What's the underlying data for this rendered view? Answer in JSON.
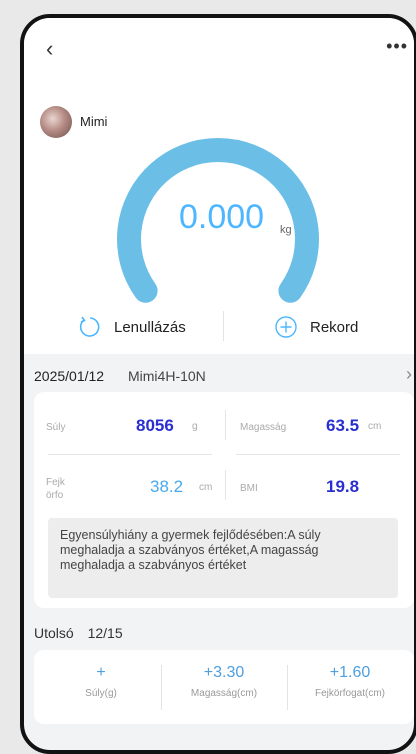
{
  "header": {
    "back_icon": "chevron-left-icon",
    "more_icon": "more-dots-icon"
  },
  "user": {
    "name": "Mimi"
  },
  "reading": {
    "weight": "0.000",
    "unit": "kg"
  },
  "actions": {
    "reset_label": "Lenullázás",
    "record_label": "Rekord"
  },
  "measurement": {
    "date": "2025/01/12",
    "device": "Mimi4H-10N",
    "weight": {
      "label": "Súly",
      "value": "8056",
      "unit": "g"
    },
    "height": {
      "label": "Magasság",
      "value": "63.5",
      "unit": "cm"
    },
    "head": {
      "label": "Fejk örfo",
      "value": "38.2",
      "unit": "cm"
    },
    "bmi": {
      "label": "BMI",
      "value": "19.8"
    },
    "warning": "Egyensúlyhiány a gyermek fejlődésében:A súly meghaladja a szabványos értéket,A magasság meghaladja a szabványos értéket"
  },
  "last": {
    "label": "Utolsó",
    "date": "12/15",
    "stats": [
      {
        "value": "+",
        "label": "Súly(g)"
      },
      {
        "value": "+3.30",
        "label": "Magasság(cm)"
      },
      {
        "value": "+1.60",
        "label": "Fejkörfogat(cm)"
      }
    ]
  },
  "colors": {
    "accent": "#4db6ff",
    "gauge": "#6bbfe6",
    "value_dark_blue": "#2a2fcf",
    "value_light_blue": "#4aa8ef"
  }
}
